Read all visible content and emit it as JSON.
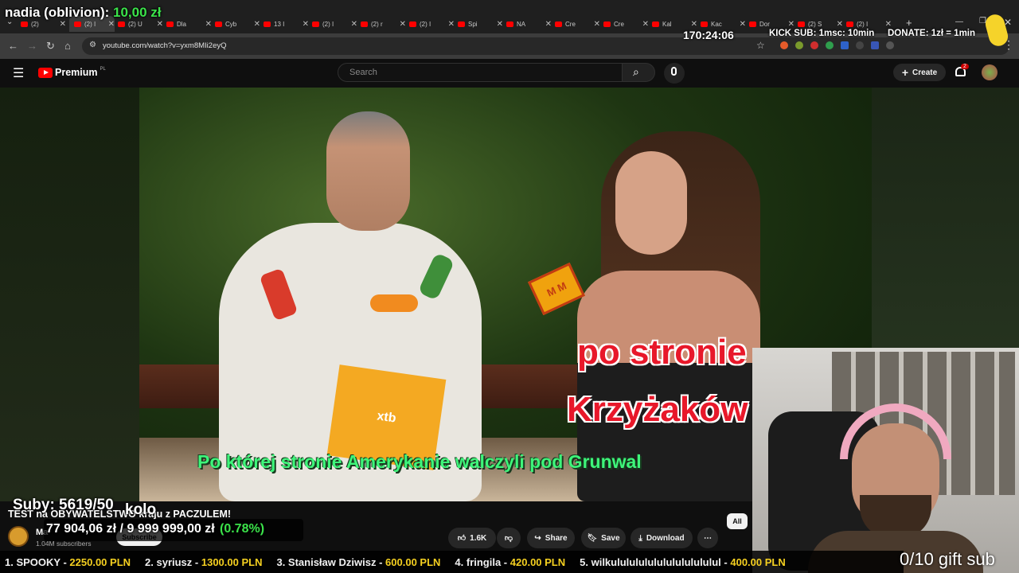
{
  "browser": {
    "tabs": [
      {
        "label": "(2)"
      },
      {
        "label": "(2) I",
        "active": true
      },
      {
        "label": "(2) U"
      },
      {
        "label": "Dla"
      },
      {
        "label": "Cyb"
      },
      {
        "label": "13 I"
      },
      {
        "label": "(2) I"
      },
      {
        "label": "(2) r"
      },
      {
        "label": "(2) I"
      },
      {
        "label": "Spi"
      },
      {
        "label": "NA"
      },
      {
        "label": "Cre"
      },
      {
        "label": "Cre"
      },
      {
        "label": "Kal"
      },
      {
        "label": "Kac"
      },
      {
        "label": "Dor"
      },
      {
        "label": "(2) S"
      },
      {
        "label": "(2) I"
      }
    ],
    "new_tab": "+",
    "url": "youtube.com/watch?v=yxm8MIi2eyQ"
  },
  "youtube": {
    "logo": "Premium",
    "region": "PL",
    "search_placeholder": "Search",
    "create_label": "Create",
    "notif_count": "2"
  },
  "video": {
    "overlay_line1": "po stronie",
    "overlay_line2": "Krzyżaków",
    "subtitle": "Po której stronie Amerykanie walczyli pod Grunwal",
    "mic_logo": "M M",
    "folder_logo": "xtb"
  },
  "below": {
    "title": "TEST na OBYWATELSTWO kraju z PACZULEM!",
    "channel": "Ma",
    "subscribers": "1.04M subscribers",
    "subscribe": "Subscribe",
    "likes": "1.6K",
    "share": "Share",
    "save": "Save",
    "download": "Download",
    "filter_all": "All"
  },
  "stream": {
    "donor_name": "nadia (oblivion):",
    "donor_amount": "10,00 zł",
    "timer": "170:24:06",
    "kick_sub": "KICK SUB: 1msc: 10min",
    "donate_rate": "DONATE: 1zł = 1min",
    "sub_goal": "Suby: 5619/50",
    "sub_goal_suffix": "kolo",
    "goal_current": "77 904,06 zł",
    "goal_target": "9 999 999,00 zł",
    "goal_pct": "(0.78%)",
    "leaderboard": [
      {
        "rank": "1. SPOOKY -",
        "amount": "2250.00 PLN"
      },
      {
        "rank": "2. syriusz -",
        "amount": "1300.00 PLN"
      },
      {
        "rank": "3. Stanisław Dziwisz -",
        "amount": "600.00 PLN"
      },
      {
        "rank": "4. fringila -",
        "amount": "420.00 PLN"
      },
      {
        "rank": "5. wilkulululululululululululul -",
        "amount": "400.00 PLN"
      }
    ],
    "gift_sub": "0/10 gift sub"
  }
}
